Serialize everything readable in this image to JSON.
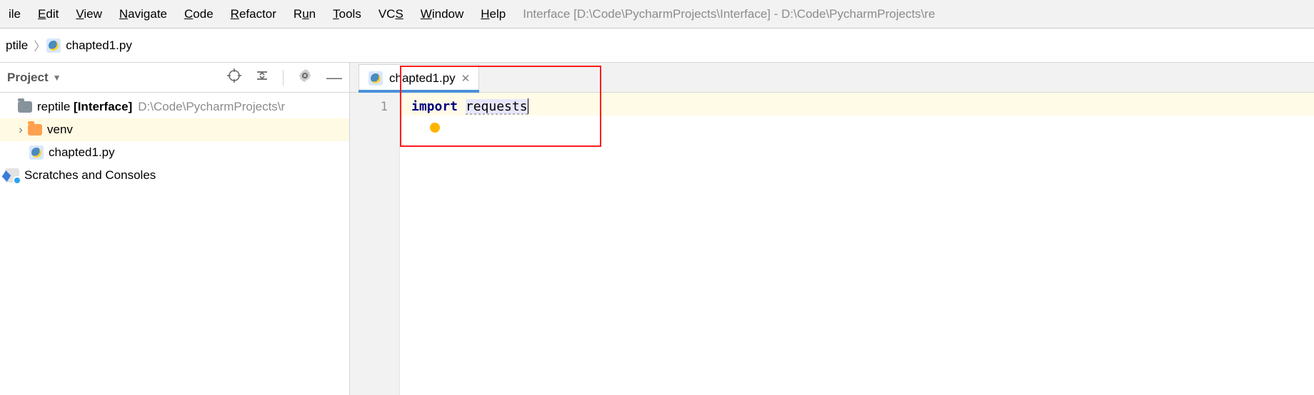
{
  "menu": {
    "items": [
      {
        "pre": "",
        "mn": "",
        "post": "ile"
      },
      {
        "pre": "",
        "mn": "E",
        "post": "dit"
      },
      {
        "pre": "",
        "mn": "V",
        "post": "iew"
      },
      {
        "pre": "",
        "mn": "N",
        "post": "avigate"
      },
      {
        "pre": "",
        "mn": "C",
        "post": "ode"
      },
      {
        "pre": "",
        "mn": "R",
        "post": "efactor"
      },
      {
        "pre": "R",
        "mn": "u",
        "post": "n"
      },
      {
        "pre": "",
        "mn": "T",
        "post": "ools"
      },
      {
        "pre": "VC",
        "mn": "S",
        "post": ""
      },
      {
        "pre": "",
        "mn": "W",
        "post": "indow"
      },
      {
        "pre": "",
        "mn": "H",
        "post": "elp"
      }
    ],
    "window_title": "Interface [D:\\Code\\PycharmProjects\\Interface] - D:\\Code\\PycharmProjects\\re"
  },
  "breadcrumb": {
    "items": [
      "ptile",
      "chapted1.py"
    ]
  },
  "project_panel": {
    "title": "Project",
    "root_name": "reptile",
    "root_label": "[Interface]",
    "root_path": "D:\\Code\\PycharmProjects\\r",
    "venv": "venv",
    "file": "chapted1.py",
    "scratches": "Scratches and Consoles"
  },
  "editor": {
    "tab_label": "chapted1.py",
    "gutter_line": "1",
    "code_keyword": "import",
    "code_module": "requests"
  }
}
